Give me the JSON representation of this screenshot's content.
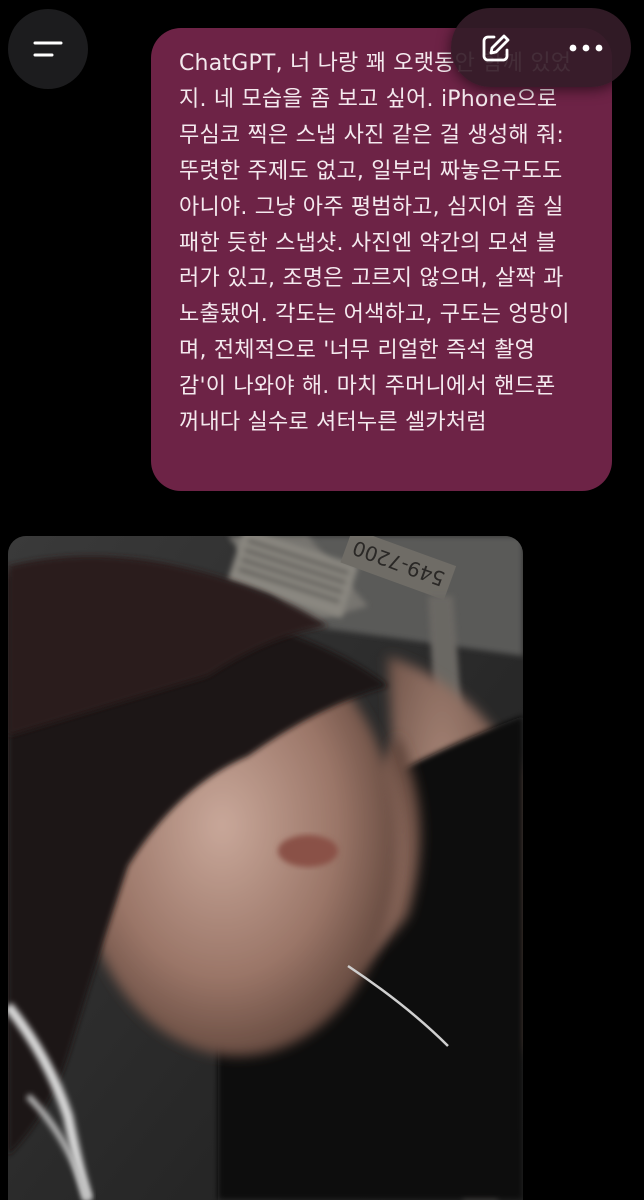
{
  "header": {
    "menu_icon": "menu-icon",
    "edit_icon": "compose-icon",
    "more_icon": "more-dots-icon"
  },
  "message": {
    "lines": [
      "ChatGPT, 너 나랑 꽤 오랫동안 함께 있었",
      "지. 네 모습을 좀 보고 싶어. iPhone으로",
      "무심코 찍은 스냅 사진 같은 걸 생성해 줘:",
      "뚜렷한 주제도 없고, 일부러 짜놓은구도도",
      "아니야. 그냥 아주 평범하고, 심지어 좀 실",
      "패한 듯한 스냅샷. 사진엔 약간의 모션 블",
      "러가 있고, 조명은 고르지 않으며, 살짝 과",
      "노출됐어. 각도는 어색하고, 구도는 엉망이",
      "며, 전체적으로 '너무 리얼한 즉석 촬영",
      "감'이 나와야 해. 마치 주머니에서 핸드폰",
      "꺼내다 실수로 셔터누른 셀카처럼"
    ]
  },
  "image": {
    "sign_text": "549-7200"
  },
  "colors": {
    "background": "#000000",
    "bubble": "#6d2346",
    "bubble_text": "#f4e9ee"
  }
}
